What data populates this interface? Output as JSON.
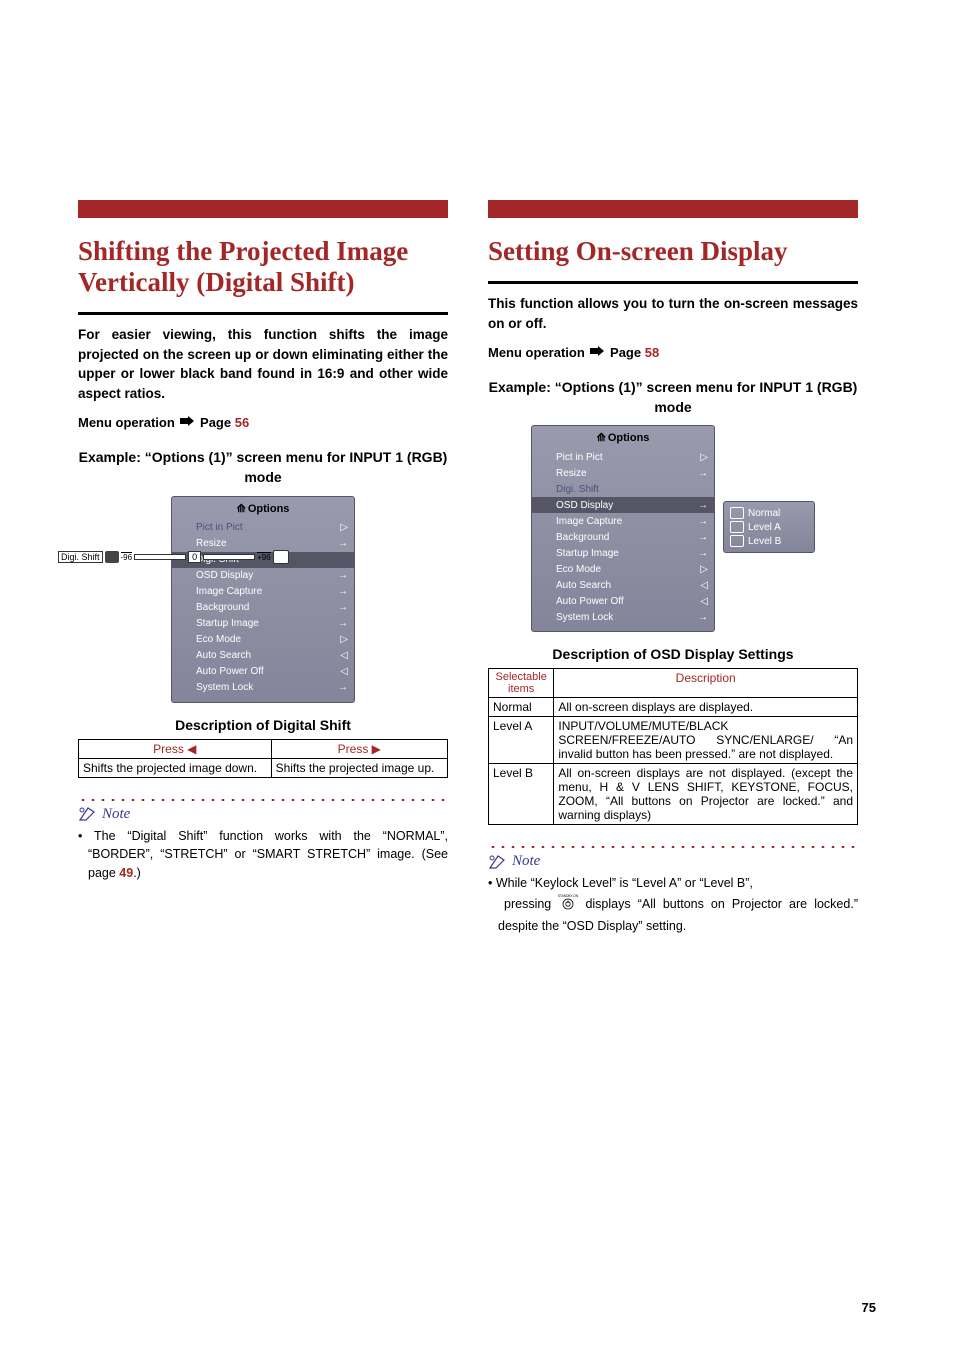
{
  "left": {
    "title": "Shifting the Projected Image Vertically (Digital Shift)",
    "lead": "For easier viewing, this function shifts the image projected on the screen up or down eliminating either the upper or lower black band found in 16:9 and other wide aspect ratios.",
    "menuop_prefix": "Menu operation",
    "menuop_page_label": "Page",
    "menuop_page": "56",
    "example_hd": "Example: “Options (1)” screen menu for INPUT 1 (RGB) mode",
    "osd_title": "Options",
    "osd_items": [
      "Pict in Pict",
      "Resize",
      "Digi. Shift",
      "OSD Display",
      "Image Capture",
      "Background",
      "Startup Image",
      "Eco Mode",
      "Auto Search",
      "Auto Power Off",
      "System Lock"
    ],
    "digi_label": "Digi. Shift",
    "digi_min": "-96",
    "digi_val": "0",
    "digi_max": "+96",
    "desc_hd": "Description of Digital Shift",
    "table": {
      "h1": "Press ◀",
      "h2": "Press ▶",
      "c1": "Shifts the projected image down.",
      "c2": "Shifts the projected image up."
    },
    "note_label": "Note",
    "note_text_a": "The “Digital Shift” function works with the “NORMAL”, “BORDER”, “STRETCH” or “SMART STRETCH” image. (See page ",
    "note_page": "49",
    "note_text_b": ".)"
  },
  "right": {
    "title": "Setting On-screen Display",
    "lead": "This function allows you to turn the on-screen messages on or off.",
    "menuop_prefix": "Menu operation",
    "menuop_page_label": "Page",
    "menuop_page": "58",
    "example_hd": "Example: “Options (1)” screen menu for INPUT 1 (RGB) mode",
    "osd_title": "Options",
    "osd_items": [
      "Pict in Pict",
      "Resize",
      "Digi. Shift",
      "OSD Display",
      "Image Capture",
      "Background",
      "Startup Image",
      "Eco Mode",
      "Auto Search",
      "Auto Power Off",
      "System Lock"
    ],
    "flyout": [
      "Normal",
      "Level A",
      "Level B"
    ],
    "desc_hd": "Description of OSD Display Settings",
    "table": {
      "h1": "Selectable items",
      "h2": "Description",
      "r1c1": "Normal",
      "r1c2": "All on-screen displays are displayed.",
      "r2c1": "Level A",
      "r2c2": "INPUT/VOLUME/MUTE/BLACK SCREEN/FREEZE/AUTO SYNC/ENLARGE/ “An invalid button has been pressed.” are not displayed.",
      "r3c1": "Level B",
      "r3c2": "All on-screen displays are not displayed. (except the menu, H & V LENS SHIFT, KEYSTONE, FOCUS, ZOOM, “All buttons on Projector are locked.” and warning displays)"
    },
    "note_label": "Note",
    "note_line1": "While “Keylock Level” is “Level A” or “Level B”,",
    "note_line2a": "pressing ",
    "note_btn": "STANDBY-ON",
    "note_line2b": " displays “All buttons on Projector are locked.” despite the “OSD Display” setting."
  },
  "pagenum": "75"
}
